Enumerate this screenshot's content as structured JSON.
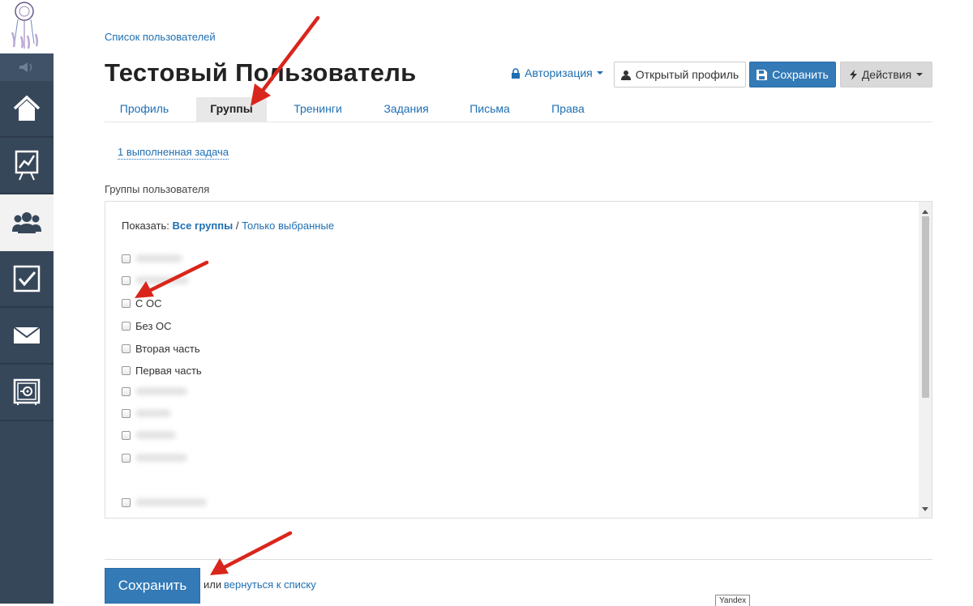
{
  "breadcrumb": "Список пользователей",
  "page_title": "Тестовый Пользователь",
  "header_actions": {
    "auth_label": "Авторизация",
    "open_profile_label": "Открытый профиль",
    "save_label": "Сохранить",
    "actions_label": "Действия"
  },
  "tabs": [
    {
      "label": "Профиль",
      "active": false
    },
    {
      "label": "Группы",
      "active": true
    },
    {
      "label": "Тренинги",
      "active": false
    },
    {
      "label": "Задания",
      "active": false
    },
    {
      "label": "Письма",
      "active": false
    },
    {
      "label": "Права",
      "active": false
    }
  ],
  "tasks_link": "1 выполненная задача",
  "groups_section": {
    "label": "Группы пользователя",
    "show_label": "Показать:",
    "filter_all": "Все группы",
    "filter_separator": "/",
    "filter_selected": "Только выбранные",
    "groups": [
      {
        "label": "",
        "blurred": true,
        "checked": false
      },
      {
        "label": "",
        "blurred": true,
        "checked": false
      },
      {
        "label": "С ОС",
        "blurred": false,
        "checked": false
      },
      {
        "label": "Без ОС",
        "blurred": false,
        "checked": false
      },
      {
        "label": "Вторая часть",
        "blurred": false,
        "checked": false
      },
      {
        "label": "Первая часть",
        "blurred": false,
        "checked": false
      },
      {
        "label": "",
        "blurred": true,
        "checked": false
      },
      {
        "label": "",
        "blurred": true,
        "checked": false
      },
      {
        "label": "",
        "blurred": true,
        "checked": false
      },
      {
        "label": "",
        "blurred": true,
        "checked": false
      },
      {
        "label": "",
        "blurred": true,
        "checked": false
      }
    ]
  },
  "footer": {
    "save_label": "Сохранить",
    "or_text": "или",
    "back_link": "вернуться к списку"
  },
  "tooltip": "Yandex",
  "sidebar": {
    "items": [
      {
        "icon": "home-icon",
        "active": false
      },
      {
        "icon": "chart-board-icon",
        "active": false
      },
      {
        "icon": "users-icon",
        "active": true
      },
      {
        "icon": "checkbox-icon",
        "active": false
      },
      {
        "icon": "mail-icon",
        "active": false
      },
      {
        "icon": "safe-icon",
        "active": false
      }
    ]
  },
  "colors": {
    "sidebar_bg": "#37475a",
    "primary": "#337ab7",
    "link": "#1f6fb2",
    "annotation_arrow": "#d9261c"
  }
}
